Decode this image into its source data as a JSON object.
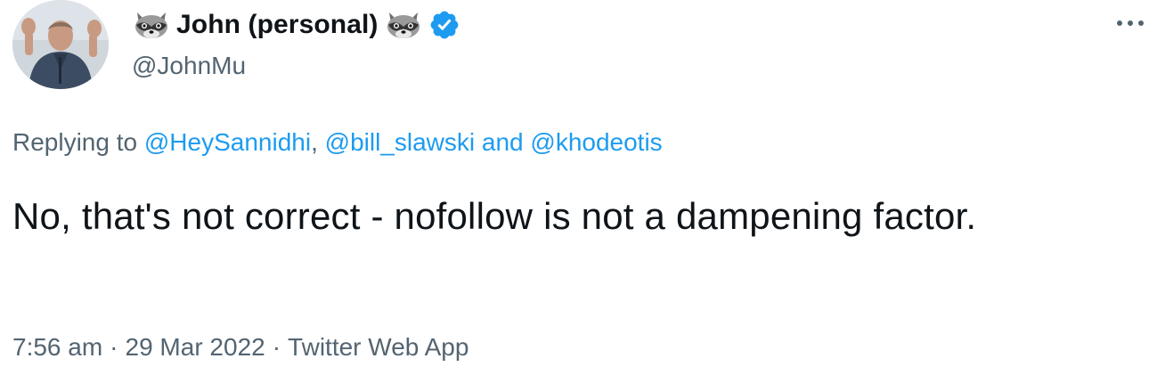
{
  "author": {
    "display_name": "John (personal)",
    "handle": "@JohnMu",
    "verified": true,
    "name_emoji": "raccoon-icon"
  },
  "reply": {
    "prefix": "Replying to ",
    "mention_1": "@HeySannidhi",
    "separator_1": ", ",
    "mention_2": "@bill_slawski",
    "and_word": " and ",
    "mention_3": "@khodeotis"
  },
  "tweet": {
    "text": "No, that's not correct - nofollow is not a dampening factor."
  },
  "meta": {
    "time": "7:56 am",
    "dot": "·",
    "date": "29 Mar 2022",
    "source": "Twitter Web App"
  },
  "colors": {
    "text": "#0f1419",
    "secondary": "#536471",
    "link": "#1d9bf0",
    "verified": "#1d9bf0"
  },
  "icons": {
    "more": "more-horizontal-icon",
    "verified": "verified-badge-icon"
  }
}
